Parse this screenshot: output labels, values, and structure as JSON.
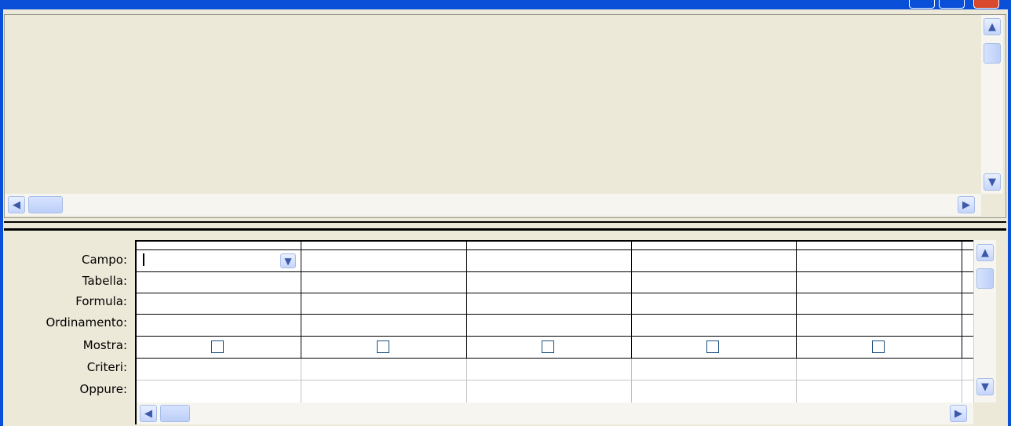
{
  "query_grid": {
    "row_labels": {
      "field": "Campo:",
      "table": "Tabella:",
      "formula": "Formula:",
      "sort": "Ordinamento:",
      "show": "Mostra:",
      "criteria": "Criteri:",
      "or": "Oppure:"
    },
    "show_checkbox_checked": [
      false,
      false,
      false,
      false,
      false
    ]
  },
  "icons": {
    "scroll_up": "▲",
    "scroll_down": "▼",
    "scroll_left": "◀",
    "scroll_right": "▶",
    "dropdown": "▼"
  },
  "colors": {
    "title_bar": "#0a4fd8",
    "window_background": "#ece9d8",
    "scroll_button": "#c6d5fb"
  }
}
